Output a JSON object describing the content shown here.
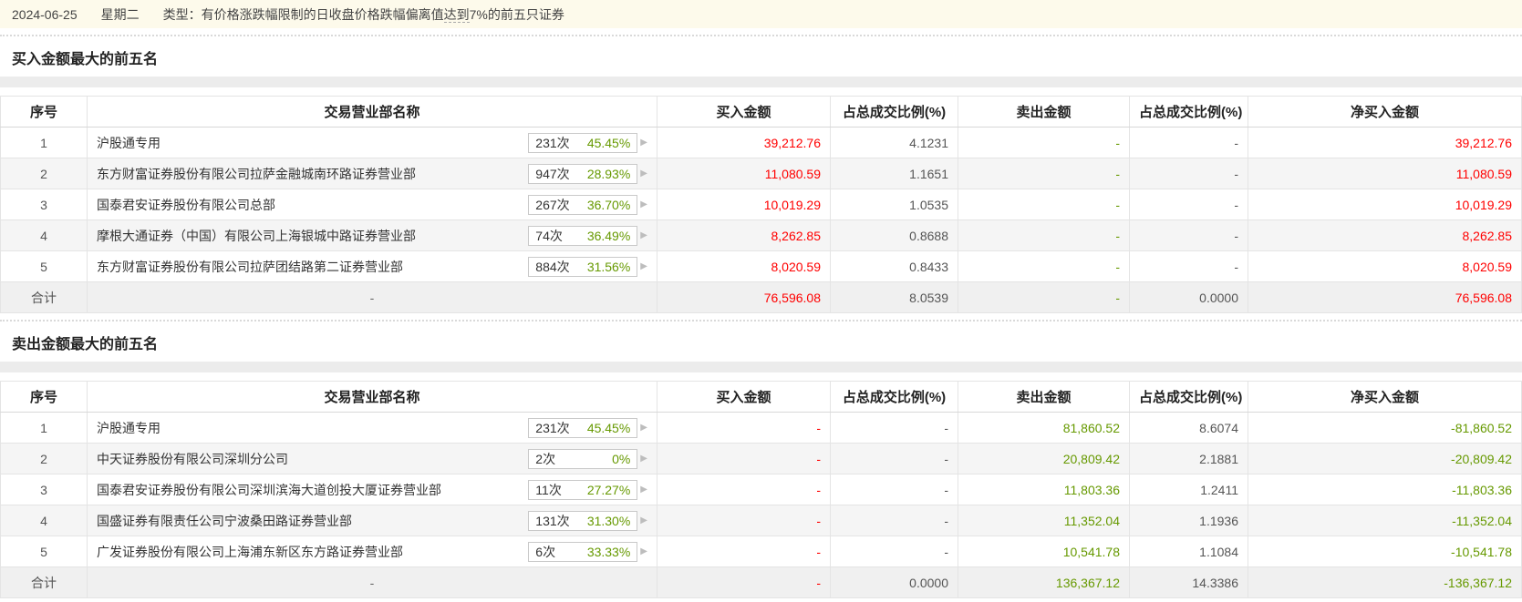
{
  "colors": {
    "red": "#ff0000",
    "green": "#669900",
    "gray_text": "#555555",
    "topbar_bg": "#fdfaeb"
  },
  "top_bar": {
    "date": "2024-06-25",
    "weekday": "星期二",
    "type_label": "类型：",
    "type_text_pre": "有价格涨跌幅限制的日收盘价格跌幅偏离值",
    "type_text_em": "达到",
    "type_text_post": "7%的前五只证券"
  },
  "columns": [
    "序号",
    "交易营业部名称",
    "买入金额",
    "占总成交比例(%)",
    "卖出金额",
    "占总成交比例(%)",
    "净买入金额"
  ],
  "buy_section": {
    "title": "买入金额最大的前五名",
    "rows": [
      {
        "no": "1",
        "name": "沪股通专用",
        "count": "231次",
        "pct": "45.45%",
        "buy": "39,212.76",
        "buy_ratio": "4.1231",
        "sell": "-",
        "sell_ratio": "-",
        "net": "39,212.76"
      },
      {
        "no": "2",
        "name": "东方财富证券股份有限公司拉萨金融城南环路证券营业部",
        "count": "947次",
        "pct": "28.93%",
        "buy": "11,080.59",
        "buy_ratio": "1.1651",
        "sell": "-",
        "sell_ratio": "-",
        "net": "11,080.59"
      },
      {
        "no": "3",
        "name": "国泰君安证券股份有限公司总部",
        "count": "267次",
        "pct": "36.70%",
        "buy": "10,019.29",
        "buy_ratio": "1.0535",
        "sell": "-",
        "sell_ratio": "-",
        "net": "10,019.29"
      },
      {
        "no": "4",
        "name": "摩根大通证券（中国）有限公司上海银城中路证券营业部",
        "count": "74次",
        "pct": "36.49%",
        "buy": "8,262.85",
        "buy_ratio": "0.8688",
        "sell": "-",
        "sell_ratio": "-",
        "net": "8,262.85"
      },
      {
        "no": "5",
        "name": "东方财富证券股份有限公司拉萨团结路第二证券营业部",
        "count": "884次",
        "pct": "31.56%",
        "buy": "8,020.59",
        "buy_ratio": "0.8433",
        "sell": "-",
        "sell_ratio": "-",
        "net": "8,020.59"
      }
    ],
    "total": {
      "no": "合计",
      "name": "-",
      "buy": "76,596.08",
      "buy_ratio": "8.0539",
      "sell": "-",
      "sell_ratio": "0.0000",
      "net": "76,596.08"
    }
  },
  "sell_section": {
    "title": "卖出金额最大的前五名",
    "rows": [
      {
        "no": "1",
        "name": "沪股通专用",
        "count": "231次",
        "pct": "45.45%",
        "buy": "-",
        "buy_ratio": "-",
        "sell": "81,860.52",
        "sell_ratio": "8.6074",
        "net": "-81,860.52"
      },
      {
        "no": "2",
        "name": "中天证券股份有限公司深圳分公司",
        "count": "2次",
        "pct": "0%",
        "buy": "-",
        "buy_ratio": "-",
        "sell": "20,809.42",
        "sell_ratio": "2.1881",
        "net": "-20,809.42"
      },
      {
        "no": "3",
        "name": "国泰君安证券股份有限公司深圳滨海大道创投大厦证券营业部",
        "count": "11次",
        "pct": "27.27%",
        "buy": "-",
        "buy_ratio": "-",
        "sell": "11,803.36",
        "sell_ratio": "1.2411",
        "net": "-11,803.36"
      },
      {
        "no": "4",
        "name": "国盛证券有限责任公司宁波桑田路证券营业部",
        "count": "131次",
        "pct": "31.30%",
        "buy": "-",
        "buy_ratio": "-",
        "sell": "11,352.04",
        "sell_ratio": "1.1936",
        "net": "-11,352.04"
      },
      {
        "no": "5",
        "name": "广发证券股份有限公司上海浦东新区东方路证券营业部",
        "count": "6次",
        "pct": "33.33%",
        "buy": "-",
        "buy_ratio": "-",
        "sell": "10,541.78",
        "sell_ratio": "1.1084",
        "net": "-10,541.78"
      }
    ],
    "total": {
      "no": "合计",
      "name": "-",
      "buy": "-",
      "buy_ratio": "0.0000",
      "sell": "136,367.12",
      "sell_ratio": "14.3386",
      "net": "-136,367.12"
    }
  },
  "icons": {
    "chevron_right": "▶"
  }
}
